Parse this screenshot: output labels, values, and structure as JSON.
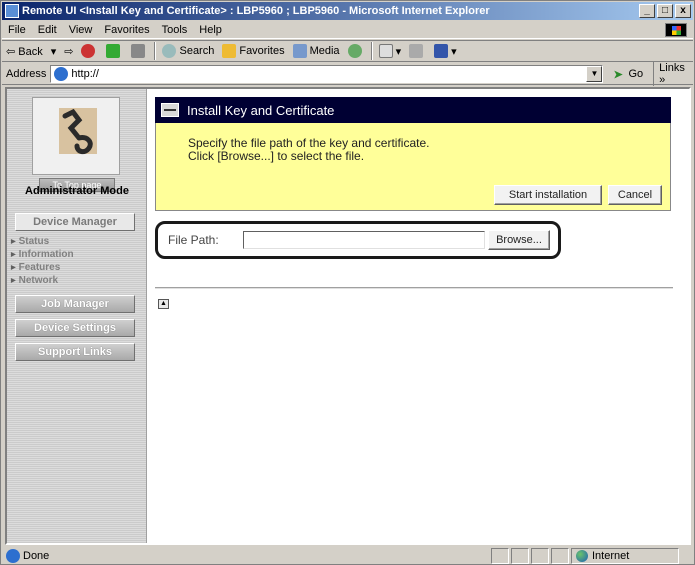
{
  "window": {
    "title": "Remote UI <Install Key and Certificate> : LBP5960 ; LBP5960 - Microsoft Internet Explorer",
    "controls": [
      "_",
      "□",
      "x"
    ]
  },
  "menu": [
    "File",
    "Edit",
    "View",
    "Favorites",
    "Tools",
    "Help"
  ],
  "toolbar": {
    "back": "⇦ Back",
    "forward": "⇨",
    "search": "Search",
    "favorites": "Favorites",
    "media": "Media"
  },
  "address": {
    "label": "Address",
    "value": "http://",
    "go": "Go",
    "links": "Links »"
  },
  "sidebar": {
    "top_page": "To Top page",
    "mode": "Administrator Mode",
    "device_manager": "Device Manager",
    "links": [
      "Status",
      "Information",
      "Features",
      "Network"
    ],
    "job_manager": "Job Manager",
    "device_settings": "Device Settings",
    "support_links": "Support Links"
  },
  "panel": {
    "title": "Install Key and Certificate",
    "line1": "Specify the file path of the key and certificate.",
    "line2": "Click [Browse...] to select the file.",
    "start": "Start installation",
    "cancel": "Cancel"
  },
  "file_path": {
    "label": "File Path:",
    "value": "",
    "browse": "Browse..."
  },
  "status": {
    "text": "Done",
    "zone": "Internet"
  }
}
